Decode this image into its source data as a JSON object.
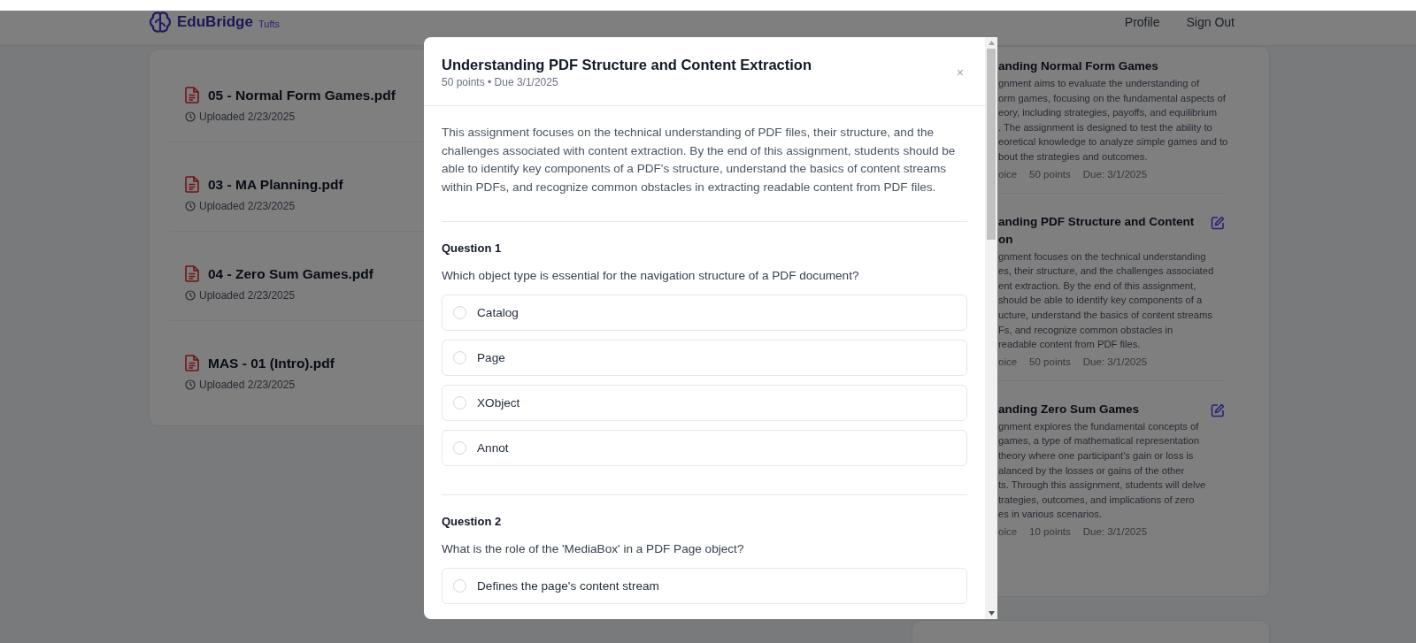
{
  "header": {
    "logo_text": "EduBridge",
    "logo_subtext": "Tufts",
    "nav": [
      "Profile",
      "Sign Out"
    ]
  },
  "files": [
    {
      "name": "05 - Normal Form Games.pdf",
      "uploaded": "Uploaded 2/23/2025"
    },
    {
      "name": "03 - MA Planning.pdf",
      "uploaded": "Uploaded 2/23/2025"
    },
    {
      "name": "04 - Zero Sum Games.pdf",
      "uploaded": "Uploaded 2/23/2025"
    },
    {
      "name": "MAS - 01 (Intro).pdf",
      "uploaded": "Uploaded 2/23/2025"
    }
  ],
  "assignments": [
    {
      "title_lines": [
        "anding Normal Form Games"
      ],
      "editable": false,
      "description_lines": [
        "gnment aims to evaluate the understanding of",
        "orm games, focusing on the fundamental aspects of",
        "eory, including strategies, payoffs, and equilibrium",
        ". The assignment is designed to test the ability to",
        "eoretical knowledge to analyze simple games and to",
        "bout the strategies and outcomes."
      ],
      "meta": [
        "oice",
        "50 points",
        "Due: 3/1/2025"
      ]
    },
    {
      "title_lines": [
        "anding PDF Structure and Content",
        "on"
      ],
      "editable": true,
      "description_lines": [
        "gnment focuses on the technical understanding",
        "es, their structure, and the challenges associated",
        "ent extraction. By the end of this assignment,",
        "should be able to identify key components of a",
        "ucture, understand the basics of content streams",
        "Fs, and recognize common obstacles in",
        "readable content from PDF files."
      ],
      "meta": [
        "oice",
        "50 points",
        "Due: 3/1/2025"
      ]
    },
    {
      "title_lines": [
        "anding Zero Sum Games"
      ],
      "editable": true,
      "description_lines": [
        "gnment explores the fundamental concepts of",
        "games, a type of mathematical representation",
        "theory where one participant's gain or loss is",
        "alanced by the losses or gains of the other",
        "ts. Through this assignment, students will delve",
        "trategies, outcomes, and implications of zero",
        "es in various scenarios."
      ],
      "meta": [
        "oice",
        "10 points",
        "Due: 3/1/2025"
      ]
    }
  ],
  "modal": {
    "title": "Understanding PDF Structure and Content Extraction",
    "subtitle": "50 points • Due 3/1/2025",
    "close": "×",
    "description": "This assignment focuses on the technical understanding of PDF files, their structure, and the challenges associated with content extraction. By the end of this assignment, students should be able to identify key components of a PDF's structure, understand the basics of content streams within PDFs, and recognize common obstacles in extracting readable content from PDF files.",
    "questions": [
      {
        "label": "Question 1",
        "text": "Which object type is essential for the navigation structure of a PDF document?",
        "options": [
          {
            "label": "Catalog",
            "selected": false
          },
          {
            "label": "Page",
            "selected": false
          },
          {
            "label": "XObject",
            "selected": false
          },
          {
            "label": "Annot",
            "selected": false
          }
        ]
      },
      {
        "label": "Question 2",
        "text": "What is the role of the 'MediaBox' in a PDF Page object?",
        "options": [
          {
            "label": "Defines the page's content stream",
            "selected": false
          }
        ]
      }
    ]
  }
}
